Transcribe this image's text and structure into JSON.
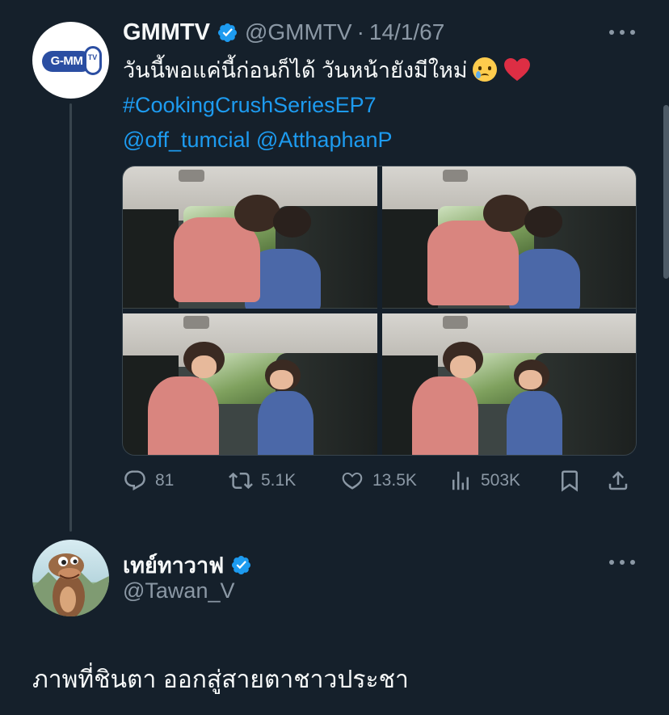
{
  "tweet": {
    "author": {
      "display_name": "GMMTV",
      "handle": "@GMMTV",
      "logo_text": "G-MM",
      "logo_ring_text": "TV"
    },
    "separator": "·",
    "date": "14/1/67",
    "text_line1": "วันนี้พอแค่นี้ก่อนก็ได้ วันหน้ายังมีใหม่",
    "hashtag": "#CookingCrushSeriesEP7",
    "mention1": "@off_tumcial",
    "mention2": "@AtthaphanP",
    "stats": {
      "replies": "81",
      "reposts": "5.1K",
      "likes": "13.5K",
      "views": "503K"
    }
  },
  "reply": {
    "author": {
      "display_name": "เทย์ทาวาฟ",
      "handle": "@Tawan_V"
    },
    "text": "ภาพที่ชินตา ออกสู่สายตาชาวประชา"
  },
  "colors": {
    "background": "#15202b",
    "accent": "#1d9bf0",
    "muted": "#8b98a5",
    "text": "#f7f9f9"
  }
}
